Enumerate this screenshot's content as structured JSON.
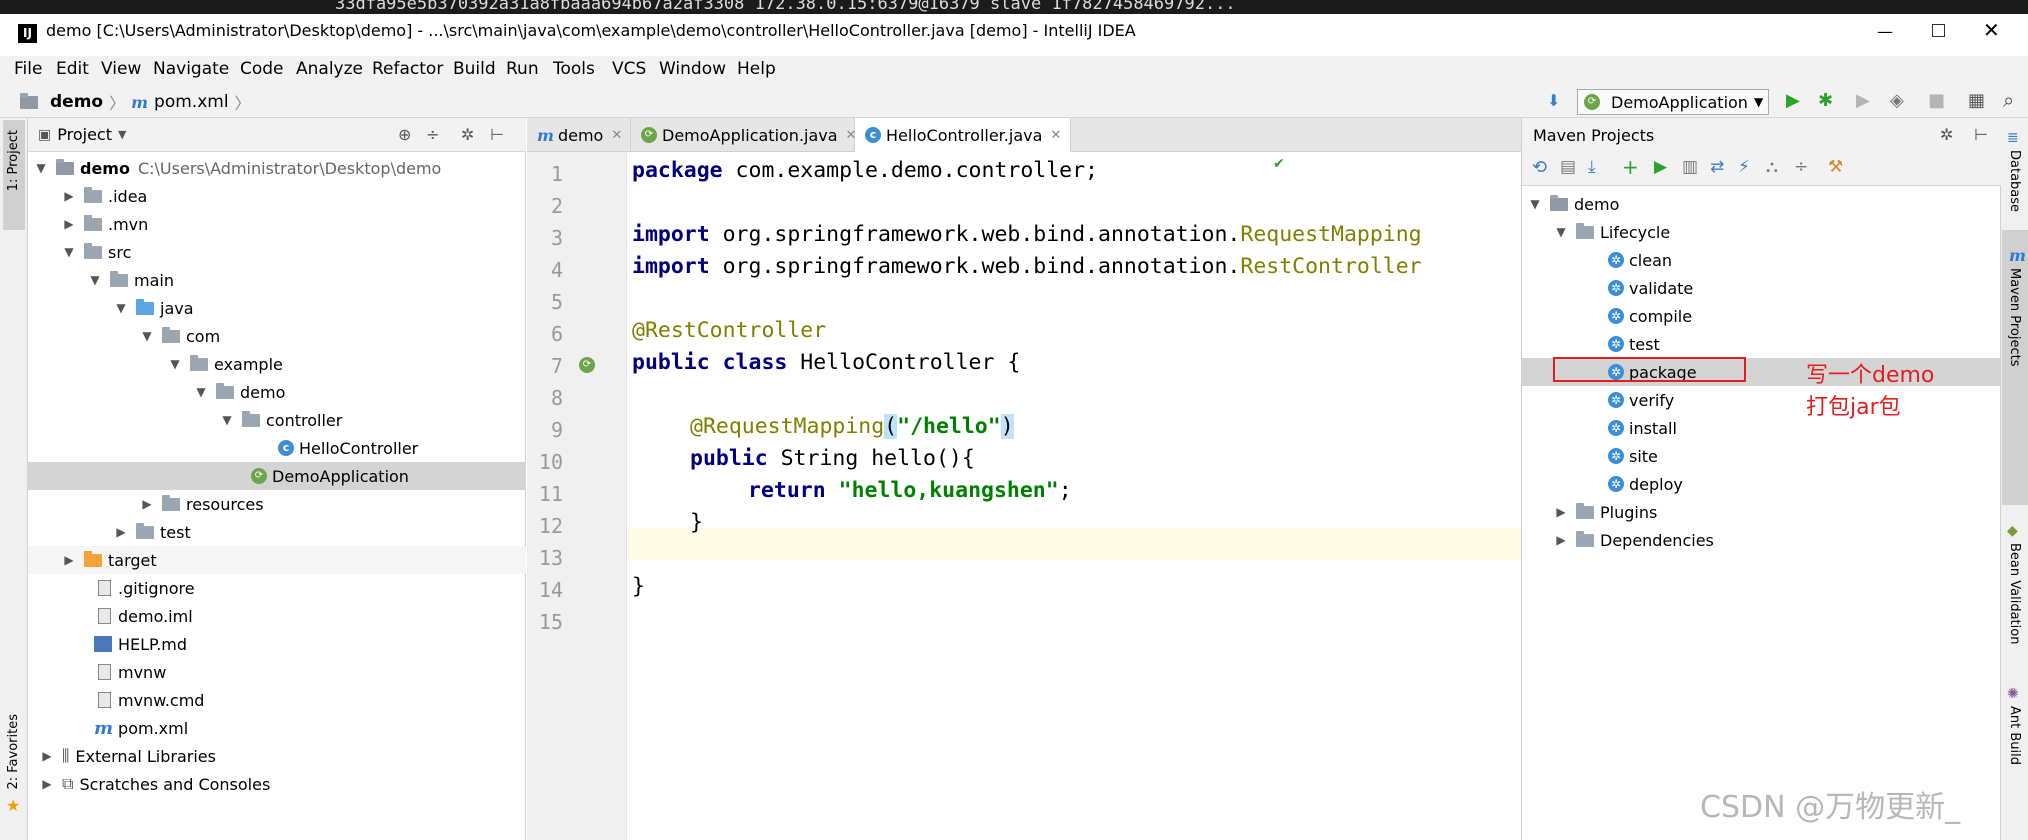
{
  "top_strip": "33dfa95e5b370392a31a8fbaaa694b67a2af3308 172.38.0.15:6379@16379 slave 1f7827458469792...",
  "window": {
    "title": "demo [C:\\Users\\Administrator\\Desktop\\demo] - ...\\src\\main\\java\\com\\example\\demo\\controller\\HelloController.java [demo] - IntelliJ IDEA",
    "logo": "IJ",
    "min": "—",
    "close": "✕"
  },
  "menu": [
    "File",
    "Edit",
    "View",
    "Navigate",
    "Code",
    "Analyze",
    "Refactor",
    "Build",
    "Run",
    "Tools",
    "VCS",
    "Window",
    "Help"
  ],
  "navbar": {
    "crumb_project": "demo",
    "crumb_file": "pom.xml",
    "run_config": "DemoApplication"
  },
  "side_left": {
    "project": "1: Project",
    "favorites": "2: Favorites"
  },
  "side_right": {
    "database": "Database",
    "maven": "Maven Projects",
    "bean": "Bean Validation",
    "ant": "Ant Build"
  },
  "project_panel": {
    "title": "Project",
    "tree": [
      {
        "label": "demo",
        "extra": "C:\\Users\\Administrator\\Desktop\\demo"
      },
      {
        "label": ".idea"
      },
      {
        "label": ".mvn"
      },
      {
        "label": "src"
      },
      {
        "label": "main"
      },
      {
        "label": "java"
      },
      {
        "label": "com"
      },
      {
        "label": "example"
      },
      {
        "label": "demo"
      },
      {
        "label": "controller"
      },
      {
        "label": "HelloController"
      },
      {
        "label": "DemoApplication"
      },
      {
        "label": "resources"
      },
      {
        "label": "test"
      },
      {
        "label": "target"
      },
      {
        "label": ".gitignore"
      },
      {
        "label": "demo.iml"
      },
      {
        "label": "HELP.md"
      },
      {
        "label": "mvnw"
      },
      {
        "label": "mvnw.cmd"
      },
      {
        "label": "pom.xml"
      },
      {
        "label": "External Libraries"
      },
      {
        "label": "Scratches and Consoles"
      }
    ]
  },
  "editor": {
    "tabs": [
      "demo",
      "DemoApplication.java",
      "HelloController.java"
    ],
    "line_numbers": [
      "1",
      "2",
      "3",
      "4",
      "5",
      "6",
      "7",
      "8",
      "9",
      "10",
      "11",
      "12",
      "13",
      "14",
      "15"
    ],
    "code": {
      "l1_kw": "package",
      "l1_rest": " com.example.demo.controller;",
      "l3_kw": "import",
      "l3_pkg": " org.springframework.web.bind.annotation.",
      "l3_cls": "RequestMapping",
      "l4_kw": "import",
      "l4_pkg": " org.springframework.web.bind.annotation.",
      "l4_cls": "RestController",
      "l6": "@RestController",
      "l7_kw": "public class",
      "l7_rest": " HelloController {",
      "l9_ann": "@RequestMapping",
      "l9_open": "(",
      "l9_str": "\"/hello\"",
      "l9_close": ")",
      "l10_kw": "public",
      "l10_rest": " String hello(){",
      "l11_kw": "return",
      "l11_str": "\"hello,kuangshen\"",
      "l11_end": ";",
      "l12": "}",
      "l14": "}"
    }
  },
  "maven_panel": {
    "title": "Maven Projects",
    "root": "demo",
    "lifecycle": "Lifecycle",
    "goals": [
      "clean",
      "validate",
      "compile",
      "test",
      "package",
      "verify",
      "install",
      "site",
      "deploy"
    ],
    "plugins": "Plugins",
    "dependencies": "Dependencies"
  },
  "annotation": {
    "line1": "写一个demo",
    "line2": "打包jar包"
  },
  "watermark": "CSDN @万物更新_",
  "colors": {
    "keyword": "#000080",
    "annotation": "#808000",
    "string": "#008000",
    "highlight": "#e02020"
  }
}
